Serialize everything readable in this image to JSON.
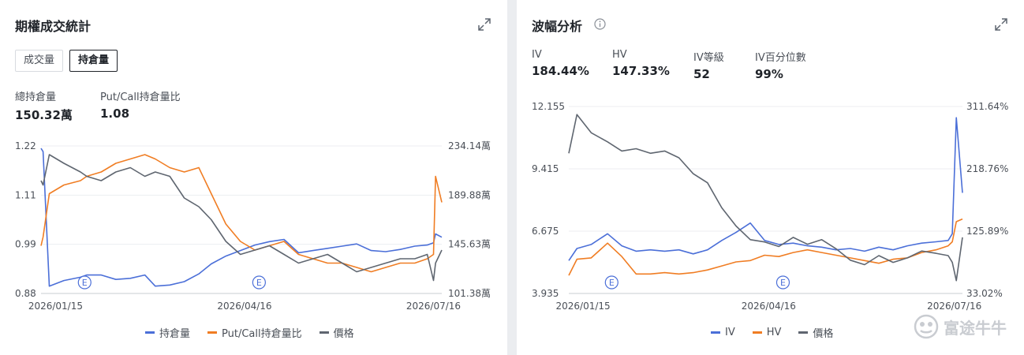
{
  "left": {
    "title": "期權成交統計",
    "tabs": [
      {
        "label": "成交量",
        "active": false
      },
      {
        "label": "持倉量",
        "active": true
      }
    ],
    "stats": [
      {
        "label": "總持倉量",
        "value": "150.32萬"
      },
      {
        "label": "Put/Call持倉量比",
        "value": "1.08"
      }
    ],
    "legend": [
      {
        "label": "持倉量",
        "color": "#4b6fd8"
      },
      {
        "label": "Put/Call持倉量比",
        "color": "#f07d23"
      },
      {
        "label": "價格",
        "color": "#5f6670"
      }
    ]
  },
  "right": {
    "title": "波幅分析",
    "stats": [
      {
        "label": "IV",
        "value": "184.44%"
      },
      {
        "label": "HV",
        "value": "147.33%"
      },
      {
        "label": "IV等級",
        "value": "52"
      },
      {
        "label": "IV百分位數",
        "value": "99%"
      }
    ],
    "legend": [
      {
        "label": "IV",
        "color": "#4b6fd8"
      },
      {
        "label": "HV",
        "color": "#f07d23"
      },
      {
        "label": "價格",
        "color": "#5f6670"
      }
    ]
  },
  "watermark": "富途牛牛",
  "icons": {
    "expand": "expand-icon",
    "info": "info-icon",
    "earnings": "earnings-marker-icon"
  },
  "chart_data": [
    {
      "type": "line",
      "title": "期權成交統計",
      "x_ticks": [
        "2026/01/15",
        "2026/04/16",
        "2026/07/16"
      ],
      "x_range": [
        "2026/01/08",
        "2026/07/20"
      ],
      "left_axis": {
        "ticks": [
          "1.22",
          "1.11",
          "0.99",
          "0.88"
        ],
        "range": [
          0.88,
          1.22
        ]
      },
      "right_axis": {
        "ticks": [
          "234.14萬",
          "189.88萬",
          "145.63萬",
          "101.38萬"
        ],
        "range": [
          101.38,
          234.14
        ],
        "unit": "萬"
      },
      "earnings_markers": [
        {
          "date": "2026/01/29",
          "label": "E"
        },
        {
          "date": "2026/04/23",
          "label": "E"
        }
      ],
      "grid": true,
      "legend_position": "bottom",
      "series": [
        {
          "name": "持倉量",
          "axis": "right",
          "color": "#4b6fd8",
          "dates": [
            "2026/01/08",
            "2026/01/09",
            "2026/01/12",
            "2026/01/19",
            "2026/01/27",
            "2026/01/30",
            "2026/02/06",
            "2026/02/13",
            "2026/02/20",
            "2026/02/27",
            "2026/03/04",
            "2026/03/11",
            "2026/03/18",
            "2026/03/25",
            "2026/03/31",
            "2026/04/07",
            "2026/04/14",
            "2026/04/21",
            "2026/04/28",
            "2026/05/05",
            "2026/05/12",
            "2026/05/19",
            "2026/05/26",
            "2026/06/02",
            "2026/06/09",
            "2026/06/16",
            "2026/06/23",
            "2026/06/30",
            "2026/07/07",
            "2026/07/13",
            "2026/07/16",
            "2026/07/17",
            "2026/07/20"
          ],
          "values": [
            232,
            229,
            108,
            113,
            116,
            118,
            118,
            114,
            115,
            118,
            108,
            109,
            112,
            119,
            128,
            135,
            140,
            145,
            148,
            150,
            138,
            140,
            142,
            144,
            146,
            140,
            139,
            141,
            144,
            145,
            147,
            155,
            152
          ]
        },
        {
          "name": "Put/Call持倉量比",
          "axis": "left",
          "color": "#f07d23",
          "dates": [
            "2026/01/08",
            "2026/01/09",
            "2026/01/12",
            "2026/01/19",
            "2026/01/27",
            "2026/01/30",
            "2026/02/06",
            "2026/02/13",
            "2026/02/20",
            "2026/02/27",
            "2026/03/04",
            "2026/03/11",
            "2026/03/18",
            "2026/03/25",
            "2026/03/31",
            "2026/04/07",
            "2026/04/14",
            "2026/04/21",
            "2026/04/28",
            "2026/05/05",
            "2026/05/12",
            "2026/05/19",
            "2026/05/26",
            "2026/06/02",
            "2026/06/09",
            "2026/06/16",
            "2026/06/23",
            "2026/06/30",
            "2026/07/07",
            "2026/07/13",
            "2026/07/16",
            "2026/07/17",
            "2026/07/20"
          ],
          "values": [
            0.99,
            1.01,
            1.11,
            1.13,
            1.14,
            1.15,
            1.16,
            1.18,
            1.19,
            1.2,
            1.19,
            1.17,
            1.16,
            1.17,
            1.11,
            1.04,
            1.0,
            0.98,
            0.99,
            1.0,
            0.97,
            0.96,
            0.95,
            0.95,
            0.94,
            0.93,
            0.94,
            0.95,
            0.95,
            0.96,
            0.97,
            1.15,
            1.09
          ]
        },
        {
          "name": "價格",
          "axis": "left",
          "color": "#5f6670",
          "dates": [
            "2026/01/08",
            "2026/01/09",
            "2026/01/12",
            "2026/01/19",
            "2026/01/27",
            "2026/01/30",
            "2026/02/06",
            "2026/02/13",
            "2026/02/20",
            "2026/02/27",
            "2026/03/04",
            "2026/03/11",
            "2026/03/18",
            "2026/03/25",
            "2026/03/31",
            "2026/04/07",
            "2026/04/14",
            "2026/04/21",
            "2026/04/28",
            "2026/05/05",
            "2026/05/12",
            "2026/05/19",
            "2026/05/26",
            "2026/06/02",
            "2026/06/09",
            "2026/06/16",
            "2026/06/23",
            "2026/06/30",
            "2026/07/07",
            "2026/07/13",
            "2026/07/16",
            "2026/07/17",
            "2026/07/20"
          ],
          "values": [
            1.14,
            1.13,
            1.2,
            1.18,
            1.16,
            1.15,
            1.14,
            1.16,
            1.17,
            1.15,
            1.16,
            1.15,
            1.1,
            1.08,
            1.05,
            1.0,
            0.97,
            0.98,
            0.99,
            0.97,
            0.95,
            0.96,
            0.97,
            0.95,
            0.93,
            0.94,
            0.95,
            0.96,
            0.96,
            0.97,
            0.91,
            0.95,
            0.98
          ]
        }
      ]
    },
    {
      "type": "line",
      "title": "波幅分析",
      "x_ticks": [
        "2026/01/15",
        "2026/04/16",
        "2026/07/16"
      ],
      "x_range": [
        "2026/01/08",
        "2026/07/20"
      ],
      "left_axis": {
        "ticks": [
          "12.155",
          "9.415",
          "6.675",
          "3.935"
        ],
        "range": [
          3.935,
          12.155
        ]
      },
      "right_axis": {
        "ticks": [
          "311.64%",
          "218.76%",
          "125.89%",
          "33.02%"
        ],
        "range": [
          33.02,
          311.64
        ],
        "unit": "%"
      },
      "earnings_markers": [
        {
          "date": "2026/01/29",
          "label": "E"
        },
        {
          "date": "2026/04/23",
          "label": "E"
        }
      ],
      "grid": true,
      "legend_position": "bottom",
      "series": [
        {
          "name": "IV",
          "axis": "right",
          "color": "#4b6fd8",
          "dates": [
            "2026/01/08",
            "2026/01/12",
            "2026/01/19",
            "2026/01/27",
            "2026/02/03",
            "2026/02/10",
            "2026/02/17",
            "2026/02/24",
            "2026/03/03",
            "2026/03/10",
            "2026/03/17",
            "2026/03/24",
            "2026/03/31",
            "2026/04/07",
            "2026/04/14",
            "2026/04/21",
            "2026/04/28",
            "2026/05/05",
            "2026/05/12",
            "2026/05/19",
            "2026/05/26",
            "2026/06/02",
            "2026/06/09",
            "2026/06/16",
            "2026/06/23",
            "2026/06/30",
            "2026/07/07",
            "2026/07/13",
            "2026/07/15",
            "2026/07/17",
            "2026/07/20"
          ],
          "values": [
            82,
            100,
            106,
            122,
            104,
            96,
            98,
            96,
            98,
            92,
            98,
            112,
            124,
            138,
            112,
            106,
            108,
            104,
            102,
            98,
            100,
            96,
            102,
            98,
            104,
            108,
            110,
            112,
            122,
            295,
            183
          ]
        },
        {
          "name": "HV",
          "axis": "right",
          "color": "#f07d23",
          "dates": [
            "2026/01/08",
            "2026/01/12",
            "2026/01/19",
            "2026/01/27",
            "2026/02/03",
            "2026/02/10",
            "2026/02/17",
            "2026/02/24",
            "2026/03/03",
            "2026/03/10",
            "2026/03/17",
            "2026/03/24",
            "2026/03/31",
            "2026/04/07",
            "2026/04/14",
            "2026/04/21",
            "2026/04/28",
            "2026/05/05",
            "2026/05/12",
            "2026/05/19",
            "2026/05/26",
            "2026/06/02",
            "2026/06/09",
            "2026/06/16",
            "2026/06/23",
            "2026/06/30",
            "2026/07/07",
            "2026/07/13",
            "2026/07/15",
            "2026/07/17",
            "2026/07/20"
          ],
          "values": [
            60,
            84,
            86,
            108,
            88,
            62,
            62,
            64,
            62,
            64,
            68,
            74,
            80,
            82,
            90,
            88,
            94,
            98,
            94,
            90,
            86,
            82,
            78,
            84,
            86,
            94,
            98,
            104,
            110,
            140,
            144
          ]
        },
        {
          "name": "價格",
          "axis": "left",
          "color": "#5f6670",
          "dates": [
            "2026/01/08",
            "2026/01/12",
            "2026/01/19",
            "2026/01/27",
            "2026/02/03",
            "2026/02/10",
            "2026/02/17",
            "2026/02/24",
            "2026/03/03",
            "2026/03/10",
            "2026/03/17",
            "2026/03/24",
            "2026/03/31",
            "2026/04/07",
            "2026/04/14",
            "2026/04/21",
            "2026/04/28",
            "2026/05/05",
            "2026/05/12",
            "2026/05/19",
            "2026/05/26",
            "2026/06/02",
            "2026/06/09",
            "2026/06/16",
            "2026/06/23",
            "2026/06/30",
            "2026/07/07",
            "2026/07/13",
            "2026/07/15",
            "2026/07/17",
            "2026/07/20"
          ],
          "values": [
            10.1,
            11.8,
            11.0,
            10.6,
            10.2,
            10.3,
            10.1,
            10.2,
            9.9,
            9.2,
            8.8,
            7.7,
            6.9,
            6.3,
            6.2,
            6.0,
            6.4,
            6.1,
            6.3,
            5.9,
            5.4,
            5.2,
            5.6,
            5.3,
            5.5,
            5.8,
            5.7,
            5.6,
            5.3,
            4.5,
            6.4
          ]
        }
      ]
    }
  ]
}
